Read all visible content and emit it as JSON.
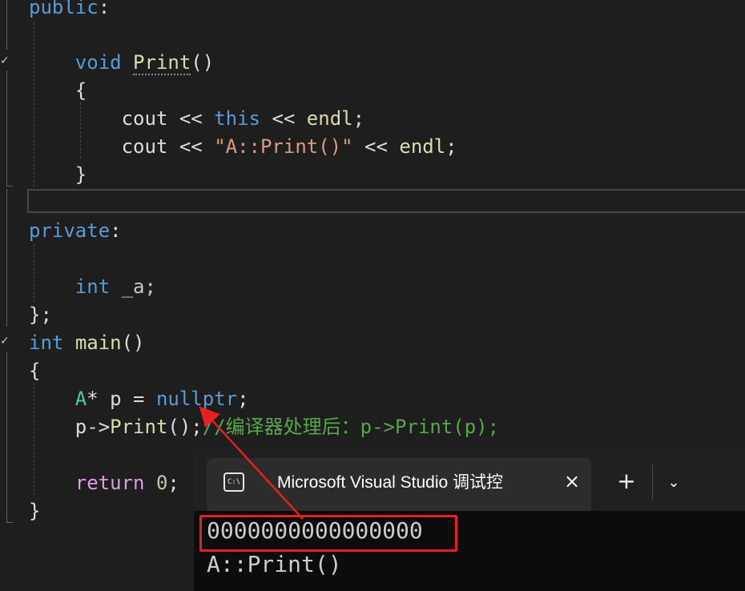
{
  "code": {
    "lines": [
      {
        "tokens": [
          {
            "t": "public",
            "c": "kw"
          },
          {
            "t": ":",
            "c": "pl"
          }
        ]
      },
      {
        "tokens": []
      },
      {
        "tokens": [
          {
            "t": "    ",
            "c": "pl"
          },
          {
            "t": "void",
            "c": "kw"
          },
          {
            "t": " ",
            "c": "pl"
          },
          {
            "t": "Print",
            "c": "fn squiggle"
          },
          {
            "t": "()",
            "c": "pl"
          }
        ]
      },
      {
        "tokens": [
          {
            "t": "    {",
            "c": "pl"
          }
        ]
      },
      {
        "tokens": [
          {
            "t": "        cout ",
            "c": "pl"
          },
          {
            "t": "<<",
            "c": "pl"
          },
          {
            "t": " ",
            "c": "pl"
          },
          {
            "t": "this",
            "c": "kw"
          },
          {
            "t": " << ",
            "c": "pl"
          },
          {
            "t": "endl",
            "c": "fn"
          },
          {
            "t": ";",
            "c": "pl"
          }
        ]
      },
      {
        "tokens": [
          {
            "t": "        cout << ",
            "c": "pl"
          },
          {
            "t": "\"A::Print()\"",
            "c": "str"
          },
          {
            "t": " << ",
            "c": "pl"
          },
          {
            "t": "endl",
            "c": "fn"
          },
          {
            "t": ";",
            "c": "pl"
          }
        ]
      },
      {
        "tokens": [
          {
            "t": "    }",
            "c": "pl"
          }
        ]
      },
      {
        "tokens": []
      },
      {
        "tokens": [
          {
            "t": "private",
            "c": "kw"
          },
          {
            "t": ":",
            "c": "pl"
          }
        ]
      },
      {
        "tokens": []
      },
      {
        "tokens": [
          {
            "t": "    ",
            "c": "pl"
          },
          {
            "t": "int",
            "c": "kw"
          },
          {
            "t": " _a;",
            "c": "vr"
          }
        ]
      },
      {
        "tokens": [
          {
            "t": "};",
            "c": "pl"
          }
        ]
      },
      {
        "tokens": [
          {
            "t": "int",
            "c": "kw"
          },
          {
            "t": " ",
            "c": "pl"
          },
          {
            "t": "main",
            "c": "fn"
          },
          {
            "t": "()",
            "c": "pl"
          }
        ]
      },
      {
        "tokens": [
          {
            "t": "{",
            "c": "pl"
          }
        ]
      },
      {
        "tokens": [
          {
            "t": "    ",
            "c": "pl"
          },
          {
            "t": "A",
            "c": "ty"
          },
          {
            "t": "* p = ",
            "c": "pl"
          },
          {
            "t": "nullptr",
            "c": "kw"
          },
          {
            "t": ";",
            "c": "pl"
          }
        ]
      },
      {
        "tokens": [
          {
            "t": "    p->",
            "c": "pl"
          },
          {
            "t": "Print",
            "c": "fn"
          },
          {
            "t": "();",
            "c": "pl"
          },
          {
            "t": "//编译器处理后：p->Print(p);",
            "c": "cm"
          }
        ]
      },
      {
        "tokens": []
      },
      {
        "tokens": [
          {
            "t": "    ",
            "c": "pl"
          },
          {
            "t": "return",
            "c": "kw2"
          },
          {
            "t": " ",
            "c": "pl"
          },
          {
            "t": "0",
            "c": "num"
          },
          {
            "t": ";",
            "c": "pl"
          }
        ]
      },
      {
        "tokens": [
          {
            "t": "}",
            "c": "pl"
          }
        ]
      }
    ]
  },
  "terminal": {
    "tab_title": "Microsoft Visual Studio 调试控",
    "tab_icon_text": "C:\\",
    "close_icon": "×",
    "new_tab_icon": "+",
    "dropdown_icon": "⌄",
    "output": [
      "0000000000000000",
      "A::Print()"
    ]
  },
  "annotation": {
    "highlight_color": "#e62020",
    "arrow_color": "#e62020"
  },
  "colors": {
    "keyword": "#569cd6",
    "control_keyword": "#d8a0df",
    "function": "#dcdcaa",
    "type": "#4ec9b0",
    "string": "#d69d85",
    "comment": "#57a64a",
    "number": "#b5cea8"
  }
}
